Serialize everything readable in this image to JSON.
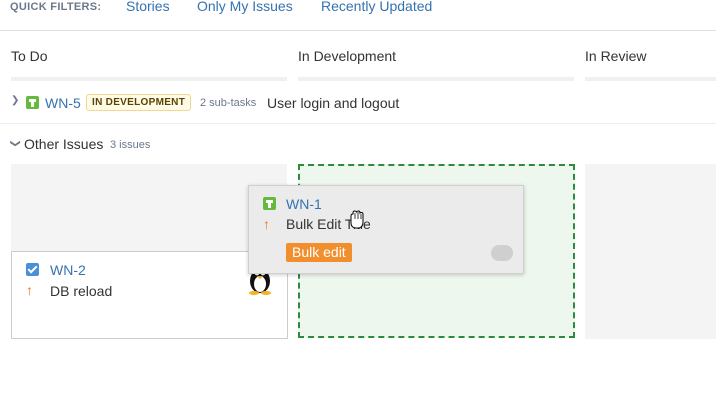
{
  "quick_filters": {
    "label": "QUICK FILTERS:",
    "items": [
      "Stories",
      "Only My Issues",
      "Recently Updated"
    ]
  },
  "columns": [
    "To Do",
    "In Development",
    "In Review"
  ],
  "swimlane": {
    "key": "WN-5",
    "status": "IN DEVELOPMENT",
    "subtasks": "2 sub-tasks",
    "summary": "User login and logout"
  },
  "other_issues": {
    "title": "Other Issues",
    "count": "3 issues"
  },
  "cards": {
    "wn2": {
      "key": "WN-2",
      "summary": "DB reload",
      "type_icon": "task-icon",
      "priority_icon": "arrow-up-icon"
    },
    "wn1": {
      "key": "WN-1",
      "summary": "Bulk Edit Title",
      "epic": "Bulk edit",
      "type_icon": "story-icon",
      "priority_icon": "arrow-up-icon"
    }
  },
  "colors": {
    "link": "#3572b0",
    "story": "#63ba3c",
    "task": "#4a90d9",
    "priority": "#e3772c",
    "epic": "#f18f2e",
    "drop_zone_border": "#2e8b3e"
  }
}
